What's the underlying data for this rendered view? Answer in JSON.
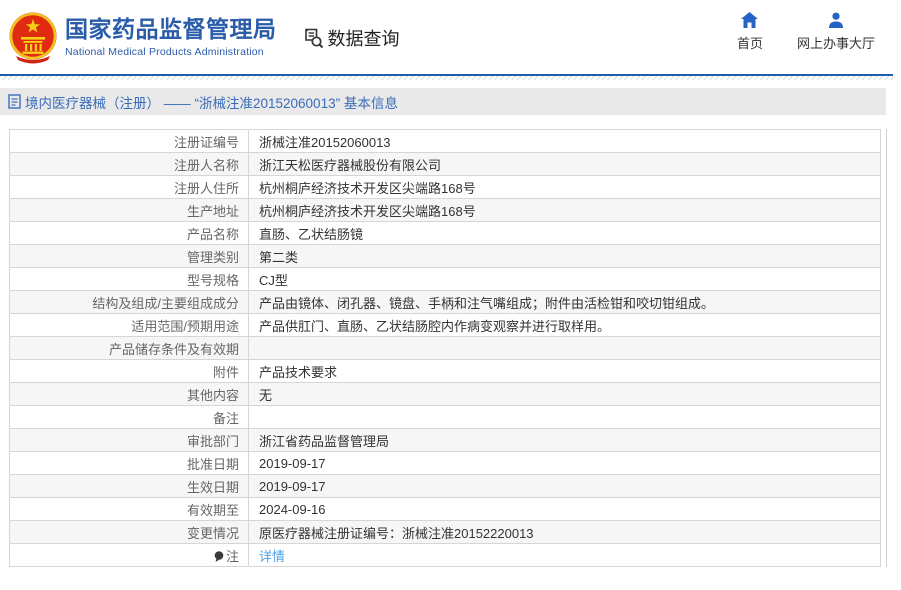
{
  "header": {
    "org_name_zh": "国家药品监督管理局",
    "org_name_en": "National Medical Products Administration",
    "section_title": "数据查询",
    "nav": {
      "home_label": "首页",
      "hall_label": "网上办事大厅"
    }
  },
  "breadcrumb": {
    "text": "境内医疗器械（注册） —— “浙械注准20152060013” 基本信息"
  },
  "table": {
    "rows": [
      {
        "label": "注册证编号",
        "value": "浙械注准20152060013"
      },
      {
        "label": "注册人名称",
        "value": "浙江天松医疗器械股份有限公司"
      },
      {
        "label": "注册人住所",
        "value": "杭州桐庐经济技术开发区尖端路168号"
      },
      {
        "label": "生产地址",
        "value": "杭州桐庐经济技术开发区尖端路168号"
      },
      {
        "label": "产品名称",
        "value": "直肠、乙状结肠镜"
      },
      {
        "label": "管理类别",
        "value": "第二类"
      },
      {
        "label": "型号规格",
        "value": "CJ型"
      },
      {
        "label": "结构及组成/主要组成成分",
        "value": "产品由镜体、闭孔器、镜盘、手柄和注气嘴组成；附件由活检钳和咬切钳组成。"
      },
      {
        "label": "适用范围/预期用途",
        "value": "产品供肛门、直肠、乙状结肠腔内作病变观察并进行取样用。"
      },
      {
        "label": "产品储存条件及有效期",
        "value": ""
      },
      {
        "label": "附件",
        "value": "产品技术要求"
      },
      {
        "label": "其他内容",
        "value": "无"
      },
      {
        "label": "备注",
        "value": ""
      },
      {
        "label": "审批部门",
        "value": "浙江省药品监督管理局"
      },
      {
        "label": "批准日期",
        "value": "2019-09-17"
      },
      {
        "label": "生效日期",
        "value": "2019-09-17"
      },
      {
        "label": "有效期至",
        "value": "2024-09-16"
      },
      {
        "label": "变更情况",
        "value": "原医疗器械注册证编号：浙械注准20152220013"
      },
      {
        "label": "注",
        "value": "详情",
        "link": true,
        "note_icon": true
      }
    ]
  },
  "colors": {
    "brand_blue": "#2a5caa",
    "divider_blue": "#1d5fae",
    "breadcrumb_text": "#3a6cb8",
    "link_blue": "#4da0e8",
    "row_alt_bg": "#f6f6f6",
    "table_border": "#d6d6d6"
  }
}
